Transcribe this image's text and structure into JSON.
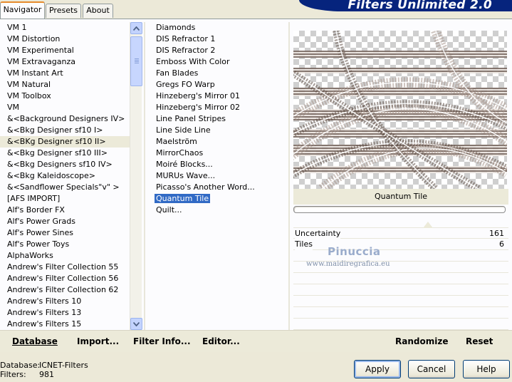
{
  "tabs": [
    {
      "label": "Navigator",
      "active": true
    },
    {
      "label": "Presets",
      "active": false
    },
    {
      "label": "About",
      "active": false
    }
  ],
  "app_title": "Filters Unlimited 2.0",
  "categories": [
    "VM 1",
    "VM Distortion",
    "VM Experimental",
    "VM Extravaganza",
    "VM Instant Art",
    "VM Natural",
    "VM Toolbox",
    "VM",
    "&<Background Designers IV>",
    "&<Bkg Designer sf10 I>",
    "&<BKg Designer sf10 II>",
    "&<Bkg Designer sf10 III>",
    "&<Bkg Designers sf10 IV>",
    "&<Bkg Kaleidoscope>",
    "&<Sandflower Specials\"v\" >",
    "[AFS IMPORT]",
    "Alf's Border FX",
    "Alf's Power Grads",
    "Alf's Power Sines",
    "Alf's Power Toys",
    "AlphaWorks",
    "Andrew's Filter Collection 55",
    "Andrew's Filter Collection 56",
    "Andrew's Filter Collection 62",
    "Andrew's Filters 10",
    "Andrew's Filters 13",
    "Andrew's Filters 15"
  ],
  "selected_category_index": 10,
  "filters": [
    "Diamonds",
    "DIS Refractor 1",
    "DIS Refractor 2",
    "Emboss With Color",
    "Fan Blades",
    "Gregs FO Warp",
    "Hinzeberg's Mirror 01",
    "Hinzeberg's Mirror 02",
    "Line Panel Stripes",
    "Line Side Line",
    "Maelström",
    "MirrorChaos",
    "Moiré Blocks...",
    "MURUs Wave...",
    "Picasso's Another Word...",
    "Quantum Tile",
    "Quilt..."
  ],
  "selected_filter_index": 15,
  "preview_filter_name": "Quantum Tile",
  "parameters": [
    {
      "label": "Uncertainty",
      "value": "161"
    },
    {
      "label": "Tiles",
      "value": "6"
    }
  ],
  "watermark": {
    "name": "Pinuccia",
    "url": "www.maidiregrafica.eu"
  },
  "toolbar": {
    "database": "Database",
    "import": "Import...",
    "filter_info": "Filter Info...",
    "editor": "Editor...",
    "randomize": "Randomize",
    "reset": "Reset"
  },
  "status": {
    "database_label": "Database:",
    "database_value": "ICNET-Filters",
    "filters_label": "Filters:",
    "filters_value": "981"
  },
  "buttons": {
    "apply": "Apply",
    "cancel": "Cancel",
    "help": "Help"
  },
  "colors": {
    "title_bar": "#06247d",
    "selection": "#316ac5",
    "tab_accent": "#e68b2c"
  }
}
